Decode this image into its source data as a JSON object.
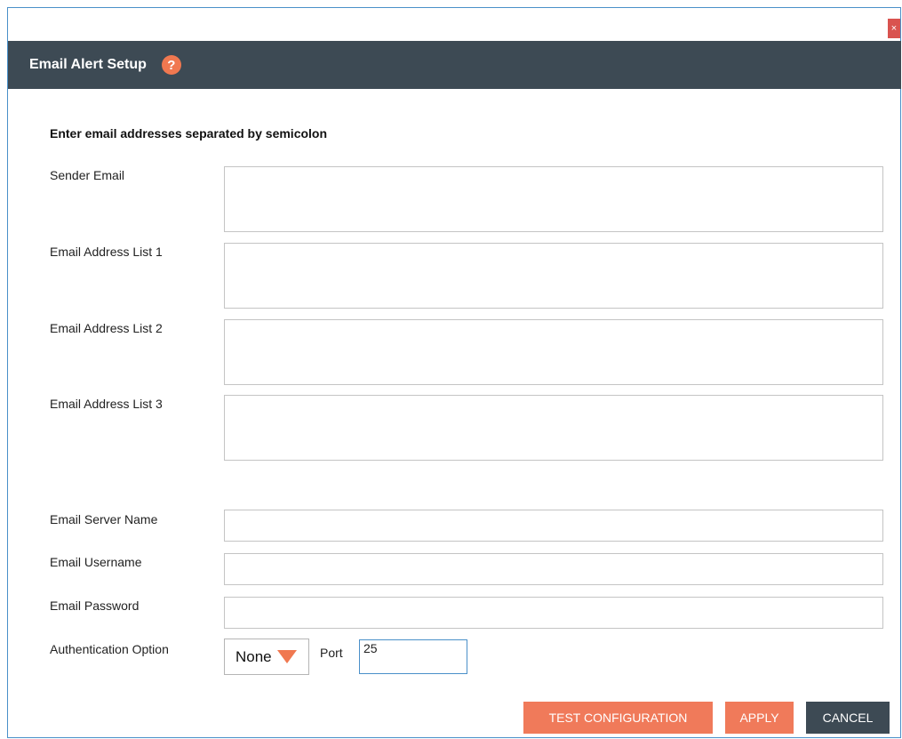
{
  "dialog": {
    "title": "Email Alert Setup",
    "close_label": "×",
    "help_label": "?"
  },
  "form": {
    "instruction": "Enter email addresses separated by semicolon",
    "sender_email_label": "Sender Email",
    "list1_label": "Email Address List 1",
    "list2_label": "Email Address List 2",
    "list3_label": "Email Address List 3",
    "server_label": "Email Server Name",
    "username_label": "Email Username",
    "password_label": "Email Password",
    "auth_label": "Authentication Option",
    "auth_value": "None",
    "port_label": "Port",
    "port_value": "25"
  },
  "buttons": {
    "test": "TEST CONFIGURATION",
    "apply": "APPLY",
    "cancel": "CANCEL"
  },
  "colors": {
    "header": "#3d4a54",
    "accent": "#f07850",
    "border": "#4a90c9"
  }
}
